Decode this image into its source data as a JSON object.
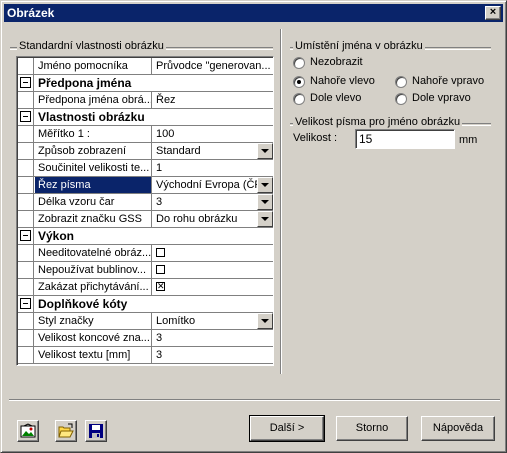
{
  "window": {
    "title": "Obrázek",
    "close_glyph": "×"
  },
  "left_group": {
    "label": "Standardní vlastnosti obrázku"
  },
  "grid": {
    "rows": [
      {
        "name": "Jméno pomocníka",
        "value": "Průvodce \"generovan..."
      },
      {
        "name": "Předpona jména",
        "section": true
      },
      {
        "name": "Předpona jména obrá...",
        "value": "Řez"
      },
      {
        "name": "Vlastnosti obrázku",
        "section": true
      },
      {
        "name": "Měřítko 1 :",
        "value": "100"
      },
      {
        "name": "Způsob zobrazení",
        "value": "Standard",
        "dropdown": true
      },
      {
        "name": "Součinitel velikosti te...",
        "value": "1"
      },
      {
        "name": "Řez písma",
        "value": "Východní Evropa (ČR",
        "dropdown": true,
        "selected": true
      },
      {
        "name": "Délka vzoru čar",
        "value": "3",
        "dropdown": true
      },
      {
        "name": "Zobrazit značku GSS",
        "value": "Do rohu obrázku",
        "dropdown": true
      },
      {
        "name": "Výkon",
        "section": true
      },
      {
        "name": "Needitovatelné obráz...",
        "checkbox": true,
        "checked": false
      },
      {
        "name": "Nepoužívat bublinov...",
        "checkbox": true,
        "checked": false
      },
      {
        "name": "Zakázat přichytávání...",
        "checkbox": true,
        "checked": true
      },
      {
        "name": "Doplňkové kóty",
        "section": true
      },
      {
        "name": "Styl značky",
        "value": "Lomítko",
        "dropdown": true
      },
      {
        "name": "Velikost koncové zna...",
        "value": "3"
      },
      {
        "name": "Velikost textu [mm]",
        "value": "3"
      }
    ]
  },
  "name_position": {
    "label": "Umístění jména v obrázku",
    "options": {
      "hide": "Nezobrazit",
      "top_left": "Nahoře vlevo",
      "top_right": "Nahoře vpravo",
      "bottom_left": "Dole vlevo",
      "bottom_right": "Dole vpravo"
    },
    "selected": "top_left"
  },
  "font_size": {
    "label": "Velikost písma pro jméno obrázku",
    "field_label": "Velikost :",
    "value": "15",
    "unit": "mm"
  },
  "buttons": {
    "next": "Další >",
    "cancel": "Storno",
    "help": "Nápověda"
  },
  "toolbar_icons": [
    "picture-icon",
    "open-folder-icon",
    "save-disk-icon"
  ],
  "colors": {
    "titlebar": "#0a246a",
    "selection": "#0a246a",
    "face": "#d4d0c8"
  }
}
